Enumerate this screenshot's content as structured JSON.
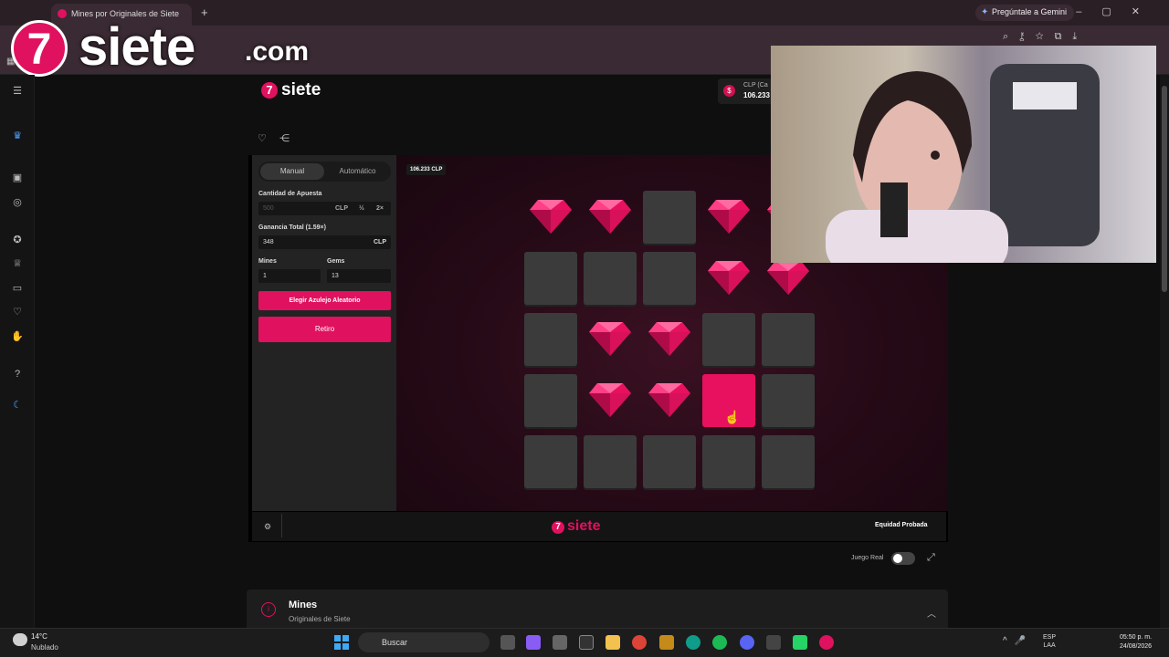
{
  "browser": {
    "tab_title": "Mines por Originales de Siete",
    "gemini_label": "Pregúntale a Gemini"
  },
  "watermark": {
    "brand": "siete",
    "suffix": ".com",
    "logo_glyph": "7"
  },
  "site": {
    "logo_text": "siete",
    "logo_glyph": "7",
    "wallet_currency": "CLP (Ca",
    "wallet_amount": "106.233",
    "wallet_glyph": "$"
  },
  "bet_panel": {
    "tabs": [
      "Manual",
      "Automático"
    ],
    "bet_amount_label": "Cantidad de Apuesta",
    "bet_amount_value": "500",
    "bet_currency": "CLP",
    "half_label": "½",
    "double_label": "2×",
    "total_profit_label": "Ganancia Total (1.59×)",
    "total_profit_value": "348",
    "profit_currency": "CLP",
    "mines_label": "Mines",
    "mines_value": "1",
    "gems_label": "Gems",
    "gems_value": "13",
    "random_tile_button": "Elegir Azulejo Aleatorio",
    "cashout_button": "Retiro"
  },
  "board": {
    "balance_badge": "106.233 CLP",
    "gem_color": "#e8115f",
    "tiles": [
      [
        "gem",
        "gem",
        "hidden",
        "gem",
        "gem"
      ],
      [
        "hidden",
        "hidden",
        "hidden",
        "gem",
        "gem"
      ],
      [
        "hidden",
        "gem",
        "gem",
        "hidden",
        "hidden"
      ],
      [
        "hidden",
        "gem",
        "gem",
        "selected",
        "hidden"
      ],
      [
        "hidden",
        "hidden",
        "hidden",
        "hidden",
        "hidden"
      ]
    ]
  },
  "footer": {
    "logo_text": "siete",
    "logo_glyph": "7",
    "fair_label": "Equidad Probada",
    "real_game_label": "Juego Real"
  },
  "info": {
    "title": "Mines",
    "subtitle": "Originales de Siete"
  },
  "taskbar": {
    "temperature": "14°C",
    "weather": "Nublado",
    "search_placeholder": "Buscar",
    "lang_line1": "ESP",
    "lang_line2": "LAA",
    "time": "05:50 p. m.",
    "date": "24/08/2026"
  },
  "colors": {
    "accent": "#e0115f",
    "panel": "#232323",
    "tile": "#3b3b3b"
  }
}
